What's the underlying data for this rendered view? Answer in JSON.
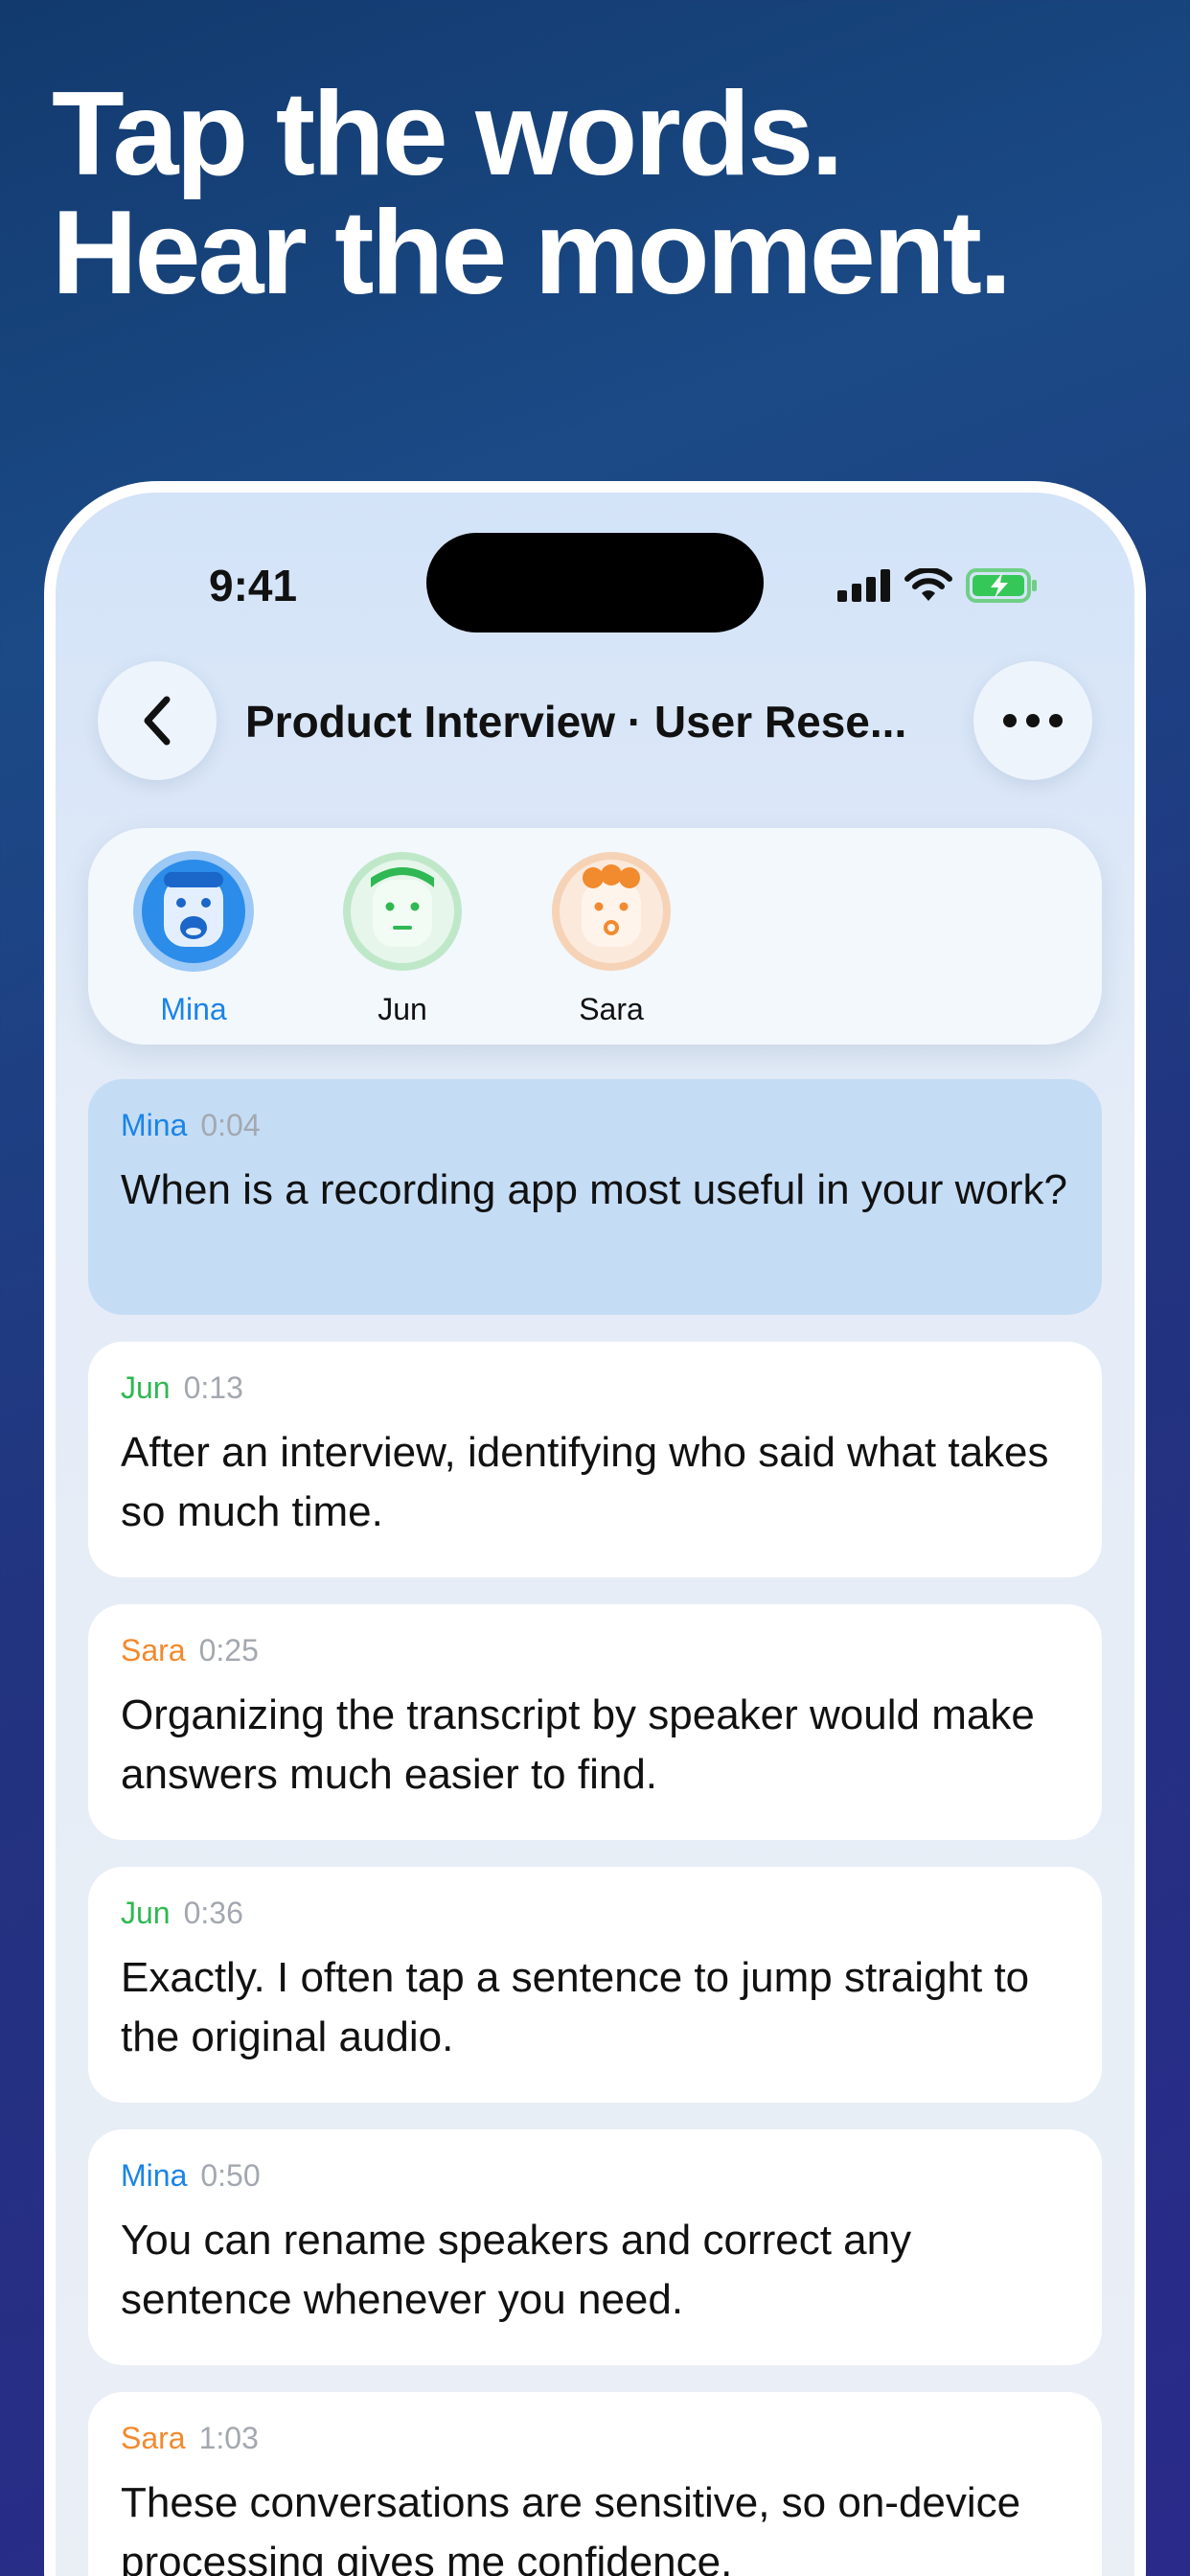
{
  "headline": {
    "line1": "Tap the words.",
    "line2": "Hear the moment."
  },
  "status_bar": {
    "time": "9:41"
  },
  "nav": {
    "title": "Product Interview · User Rese..."
  },
  "speakers": [
    {
      "name": "Mina",
      "color": "#1a84e8",
      "active": true
    },
    {
      "name": "Jun",
      "color": "#2fb853",
      "active": false
    },
    {
      "name": "Sara",
      "color": "#f28a2e",
      "active": false
    }
  ],
  "messages": [
    {
      "speaker": "Mina",
      "time": "0:04",
      "text": "When is a recording app most useful in your work?",
      "active": true
    },
    {
      "speaker": "Jun",
      "time": "0:13",
      "text": "After an interview, identifying who said what takes so much time."
    },
    {
      "speaker": "Sara",
      "time": "0:25",
      "text": "Organizing the transcript by speaker would make answers much easier to find."
    },
    {
      "speaker": "Jun",
      "time": "0:36",
      "text": "Exactly. I often tap a sentence to jump straight to the original audio."
    },
    {
      "speaker": "Mina",
      "time": "0:50",
      "text": "You can rename speakers and correct any sentence whenever you need."
    },
    {
      "speaker": "Sara",
      "time": "1:03",
      "text": "These conversations are sensitive, so on-device processing gives me confidence."
    }
  ]
}
